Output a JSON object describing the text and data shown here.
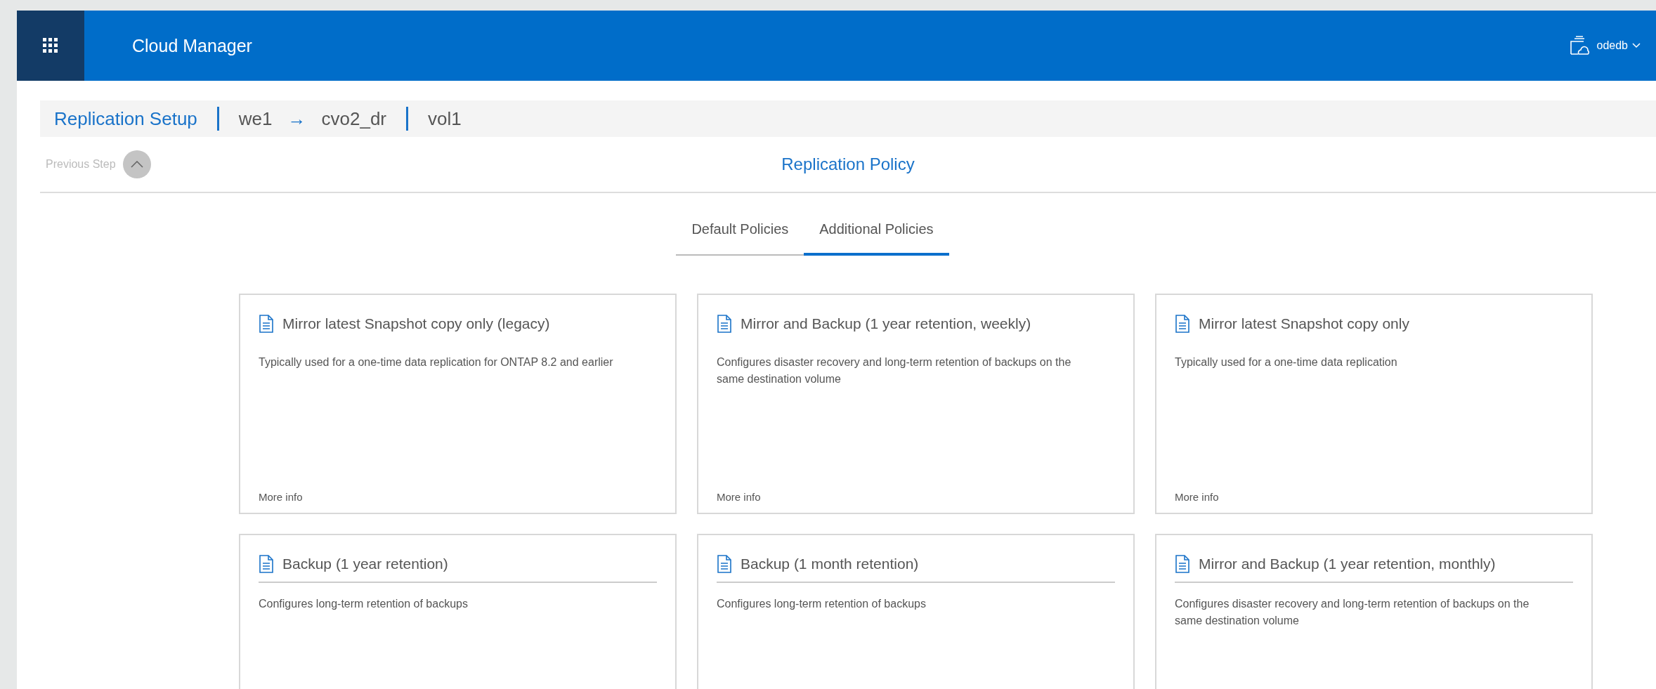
{
  "header": {
    "title": "Cloud Manager",
    "account": "odedb"
  },
  "breadcrumb": {
    "title": "Replication Setup",
    "source": "we1",
    "arrow": "→",
    "target": "cvo2_dr",
    "volume": "vol1"
  },
  "step": {
    "previous": "Previous Step",
    "title": "Replication Policy"
  },
  "tabs": [
    {
      "label": "Default Policies",
      "selected": false
    },
    {
      "label": "Additional Policies",
      "selected": true
    }
  ],
  "policies": [
    {
      "title": "Mirror latest Snapshot copy only (legacy)",
      "description": "Typically used for a one-time data replication for ONTAP 8.2 and earlier",
      "link": "More info",
      "title_rule": false
    },
    {
      "title": "Mirror and Backup (1 year retention, weekly)",
      "description": "Configures disaster recovery and long-term retention of backups on the same destination volume",
      "link": "More info",
      "title_rule": false
    },
    {
      "title": "Mirror latest Snapshot copy only",
      "description": "Typically used for a one-time data replication",
      "link": "More info",
      "title_rule": false
    },
    {
      "title": "Backup (1 year retention)",
      "description": "Configures long-term retention of backups",
      "title_rule": true
    },
    {
      "title": "Backup (1 month retention)",
      "description": "Configures long-term retention of backups",
      "title_rule": true
    },
    {
      "title": "Mirror and Backup (1 year retention, monthly)",
      "description": "Configures disaster recovery and long-term retention of backups on the same destination volume",
      "title_rule": true
    }
  ]
}
